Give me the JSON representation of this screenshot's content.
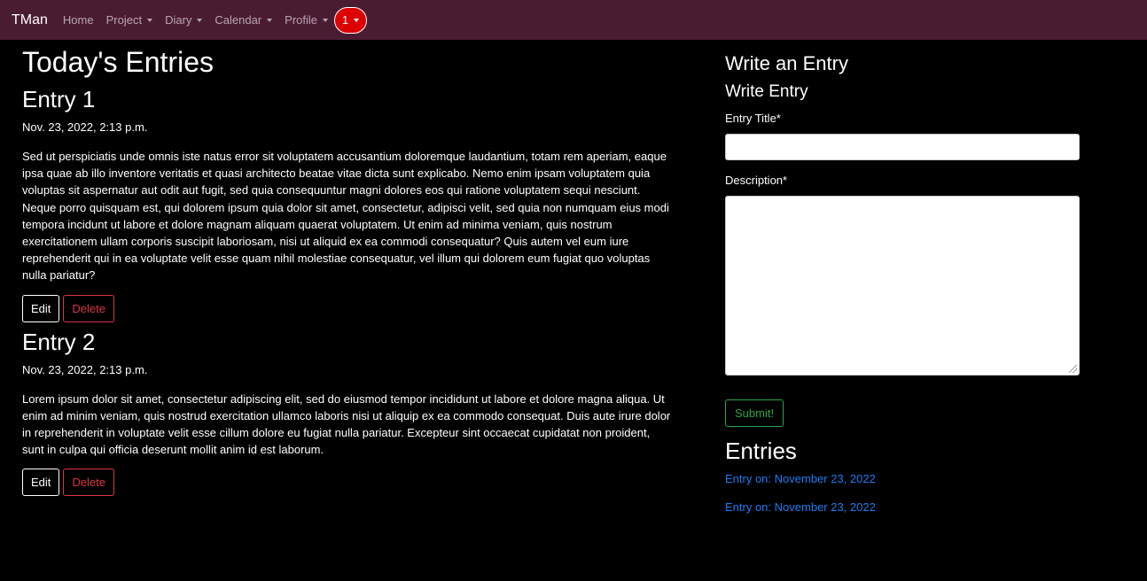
{
  "navbar": {
    "brand": "TMan",
    "items": [
      {
        "label": "Home",
        "dropdown": false
      },
      {
        "label": "Project",
        "dropdown": true
      },
      {
        "label": "Diary",
        "dropdown": true
      },
      {
        "label": "Calendar",
        "dropdown": true
      },
      {
        "label": "Profile",
        "dropdown": true
      }
    ],
    "notifications": "1",
    "colors": {
      "background": "#4a1c32",
      "notification": "#dc0000"
    }
  },
  "main": {
    "page_title": "Today's Entries",
    "entries": [
      {
        "title": "Entry 1",
        "date": "Nov. 23, 2022, 2:13 p.m.",
        "body": "Sed ut perspiciatis unde omnis iste natus error sit voluptatem accusantium doloremque laudantium, totam rem aperiam, eaque ipsa quae ab illo inventore veritatis et quasi architecto beatae vitae dicta sunt explicabo. Nemo enim ipsam voluptatem quia voluptas sit aspernatur aut odit aut fugit, sed quia consequuntur magni dolores eos qui ratione voluptatem sequi nesciunt. Neque porro quisquam est, qui dolorem ipsum quia dolor sit amet, consectetur, adipisci velit, sed quia non numquam eius modi tempora incidunt ut labore et dolore magnam aliquam quaerat voluptatem. Ut enim ad minima veniam, quis nostrum exercitationem ullam corporis suscipit laboriosam, nisi ut aliquid ex ea commodi consequatur? Quis autem vel eum iure reprehenderit qui in ea voluptate velit esse quam nihil molestiae consequatur, vel illum qui dolorem eum fugiat quo voluptas nulla pariatur?",
        "edit_label": "Edit",
        "delete_label": "Delete"
      },
      {
        "title": "Entry 2",
        "date": "Nov. 23, 2022, 2:13 p.m.",
        "body": "Lorem ipsum dolor sit amet, consectetur adipiscing elit, sed do eiusmod tempor incididunt ut labore et dolore magna aliqua. Ut enim ad minim veniam, quis nostrud exercitation ullamco laboris nisi ut aliquip ex ea commodo consequat. Duis aute irure dolor in reprehenderit in voluptate velit esse cillum dolore eu fugiat nulla pariatur. Excepteur sint occaecat cupidatat non proident, sunt in culpa qui officia deserunt mollit anim id est laborum.",
        "edit_label": "Edit",
        "delete_label": "Delete"
      }
    ]
  },
  "sidebar": {
    "heading": "Write an Entry",
    "form_title": "Write Entry",
    "title_label": "Entry Title*",
    "title_value": "",
    "description_label": "Description*",
    "description_value": "",
    "submit_label": "Submit!",
    "entries_heading": "Entries",
    "entry_links": [
      "Entry on: November 23, 2022",
      "Entry on: November 23, 2022"
    ]
  }
}
